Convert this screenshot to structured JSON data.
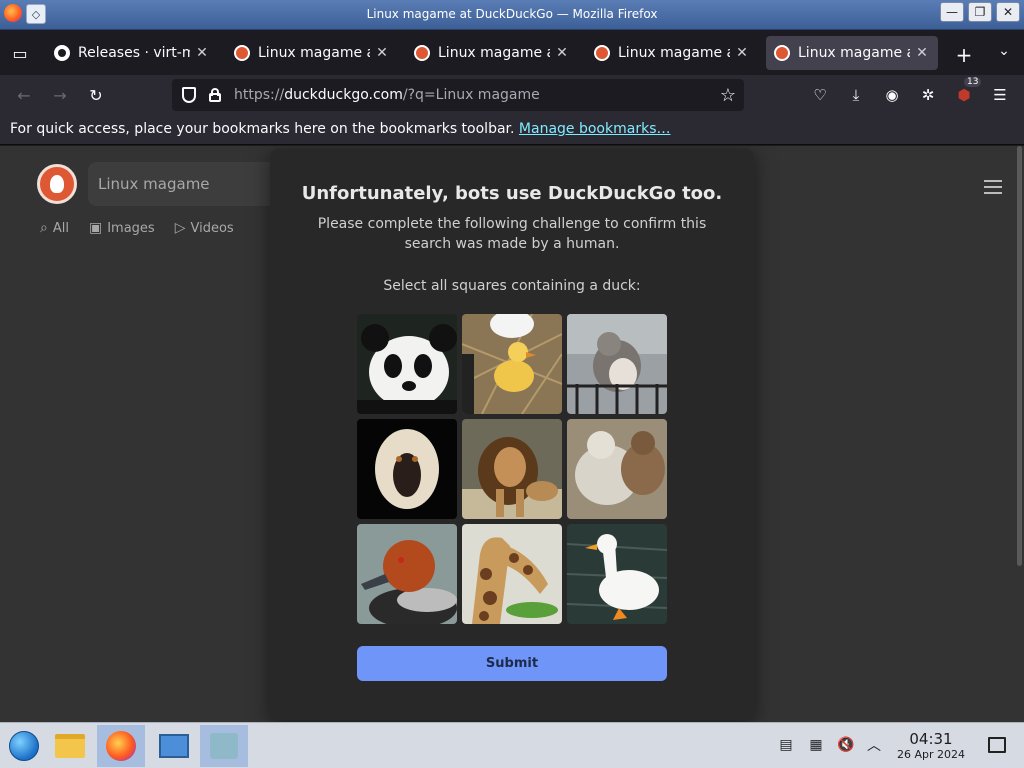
{
  "window": {
    "title": "Linux magame at DuckDuckGo — Mozilla Firefox",
    "controls": {
      "minimize": "—",
      "maximize": "❐",
      "close": "✕"
    }
  },
  "tabs": [
    {
      "label": "Releases · virt-manager",
      "favicon": "github-icon",
      "active": false
    },
    {
      "label": "Linux magame at DuckDuckGo",
      "favicon": "duckduckgo-icon",
      "active": false
    },
    {
      "label": "Linux magame at DuckDuckGo",
      "favicon": "duckduckgo-icon",
      "active": false
    },
    {
      "label": "Linux magame at DuckDuckGo",
      "favicon": "duckduckgo-icon",
      "active": false
    },
    {
      "label": "Linux magame at DuckDuckGo",
      "favicon": "duckduckgo-icon",
      "active": true
    }
  ],
  "tab_close_glyph": "✕",
  "newtab_glyph": "+",
  "tabsmenu_glyph": "⌄",
  "nav": {
    "back_glyph": "←",
    "forward_glyph": "→",
    "reload_glyph": "↻",
    "url_scheme": "https://",
    "url_host": "duckduckgo.com",
    "url_rest": "/?q=Linux magame",
    "star_glyph": "☆",
    "extensions_badge": "13"
  },
  "bookmarks_bar": {
    "message": "For quick access, place your bookmarks here on the bookmarks toolbar.",
    "link": "Manage bookmarks…"
  },
  "page": {
    "search_value": "Linux magame",
    "tabs": [
      {
        "label": "All",
        "icon": "search-icon",
        "glyph": "⌕"
      },
      {
        "label": "Images",
        "icon": "image-icon",
        "glyph": "▣"
      },
      {
        "label": "Videos",
        "icon": "play-icon",
        "glyph": "▷"
      }
    ]
  },
  "captcha": {
    "title": "Unfortunately, bots use DuckDuckGo too.",
    "subtitle": "Please complete the following challenge to confirm this search was made by a human.",
    "instruction": "Select all squares containing a duck:",
    "cells": [
      "panda",
      "duckling",
      "squirrel",
      "monkey",
      "lion",
      "bear",
      "redhead-duck",
      "giraffe",
      "white-duck"
    ],
    "submit_label": "Submit"
  },
  "taskbar": {
    "clock_time": "04:31",
    "clock_date": "26 Apr 2024"
  },
  "colors": {
    "accent": "#6f95f8",
    "ddg_orange": "#de5833",
    "link": "#80ebff"
  }
}
